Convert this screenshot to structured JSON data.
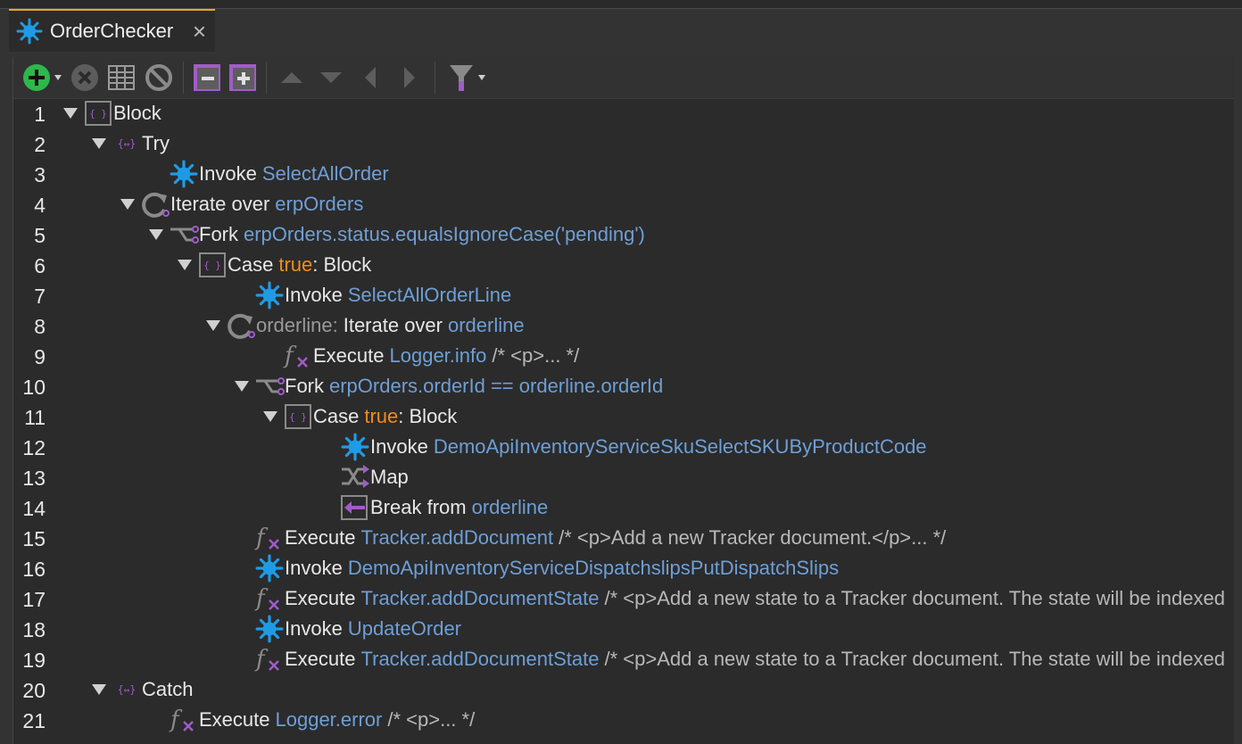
{
  "tab": {
    "title": "OrderChecker",
    "close": "×",
    "icon": "invoke-service-icon"
  },
  "toolbar": {
    "buttons": [
      "add-icon",
      "delete-icon",
      "table-icon",
      "disable-icon",
      "collapse-all-icon",
      "expand-all-icon",
      "move-up-icon",
      "move-down-icon",
      "move-left-icon",
      "move-right-icon",
      "filter-icon"
    ]
  },
  "steps": [
    {
      "line": "1",
      "icon": "block",
      "label": "Block"
    },
    {
      "line": "2",
      "icon": "try",
      "label": "Try"
    },
    {
      "line": "3",
      "icon": "invoke",
      "kw": "Invoke",
      "ref": "SelectAllOrder"
    },
    {
      "line": "4",
      "icon": "iterate",
      "kw": "Iterate over",
      "ref": "erpOrders"
    },
    {
      "line": "5",
      "icon": "fork",
      "kw": "Fork",
      "ref": "erpOrders.status.equalsIgnoreCase('pending')"
    },
    {
      "line": "6",
      "icon": "block",
      "pre": "Case",
      "val": "true",
      "post": ": Block"
    },
    {
      "line": "7",
      "icon": "invoke",
      "kw": "Invoke",
      "ref": "SelectAllOrderLine"
    },
    {
      "line": "8",
      "icon": "iterate",
      "label_pre": "orderline:",
      "kw": "Iterate over",
      "ref": "orderline"
    },
    {
      "line": "9",
      "icon": "execute",
      "kw": "Execute",
      "ref": "Logger.info",
      "comment": "/* <p>... */"
    },
    {
      "line": "10",
      "icon": "fork",
      "kw": "Fork",
      "ref": "erpOrders.orderId == orderline.orderId"
    },
    {
      "line": "11",
      "icon": "block",
      "pre": "Case",
      "val": "true",
      "post": ": Block"
    },
    {
      "line": "12",
      "icon": "invoke",
      "kw": "Invoke",
      "ref": "DemoApiInventoryServiceSkuSelectSKUByProductCode"
    },
    {
      "line": "13",
      "icon": "map",
      "kw": "Map"
    },
    {
      "line": "14",
      "icon": "break",
      "kw": "Break from",
      "ref": "orderline"
    },
    {
      "line": "15",
      "icon": "execute",
      "kw": "Execute",
      "ref": "Tracker.addDocument",
      "comment": "/* <p>Add a new Tracker document.</p>... */"
    },
    {
      "line": "16",
      "icon": "invoke",
      "kw": "Invoke",
      "ref": "DemoApiInventoryServiceDispatchslipsPutDispatchSlips"
    },
    {
      "line": "17",
      "icon": "execute",
      "kw": "Execute",
      "ref": "Tracker.addDocumentState",
      "comment": "/* <p>Add a new state to a Tracker document. The state will be indexed"
    },
    {
      "line": "18",
      "icon": "invoke",
      "kw": "Invoke",
      "ref": "UpdateOrder"
    },
    {
      "line": "19",
      "icon": "execute",
      "kw": "Execute",
      "ref": "Tracker.addDocumentState",
      "comment": "/* <p>Add a new state to a Tracker document. The state will be indexed"
    },
    {
      "line": "20",
      "icon": "try",
      "label": "Catch"
    },
    {
      "line": "21",
      "icon": "execute",
      "kw": "Execute",
      "ref": "Logger.error",
      "comment": "/* <p>... */"
    }
  ],
  "colors": {
    "reference": "#6e9fd6",
    "literal": "#f08c1e",
    "accent": "#f5a623",
    "icon_blue": "#1e9be6",
    "icon_purple": "#a05cc8"
  }
}
